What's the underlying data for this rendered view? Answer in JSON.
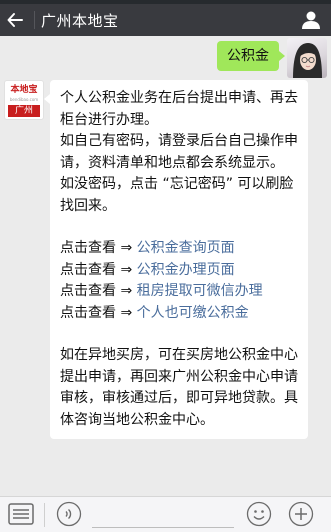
{
  "header": {
    "title": "广州本地宝"
  },
  "messages": {
    "sent": {
      "text": "公积金"
    },
    "received": {
      "avatar": {
        "brand": "本地宝",
        "domain": "bendibao.com",
        "city": "广州"
      },
      "intro": [
        "个人公积金业务在后台提出申请、再去柜台进行办理。",
        "如自己有密码，请登录后台自己操作申请，资料清单和地点都会系统显示。",
        "如没密码，点击 “忘记密码” 可以刷脸找回来。"
      ],
      "links": [
        {
          "prefix": "点击查看 ⇒ ",
          "text": "公积金查询页面"
        },
        {
          "prefix": "点击查看 ⇒ ",
          "text": "公积金办理页面"
        },
        {
          "prefix": "点击查看 ⇒ ",
          "text": "租房提取可微信办理"
        },
        {
          "prefix": "点击查看 ⇒ ",
          "text": "个人也可缴公积金"
        }
      ],
      "outro": "如在异地买房，可在买房地公积金中心提出申请，再回来广州公积金中心申请审核，审核通过后，即可异地贷款。具体咨询当地公积金中心。"
    }
  },
  "colors": {
    "header_bg": "#393a3f",
    "sent_bubble": "#a0e75a",
    "link": "#4a6d9c",
    "brand_red": "#c81e1e"
  },
  "icons": {
    "back": "back-arrow-icon",
    "profile": "person-icon",
    "menu": "menu-list-icon",
    "voice": "voice-icon",
    "emoji": "emoji-icon",
    "more": "plus-icon"
  }
}
